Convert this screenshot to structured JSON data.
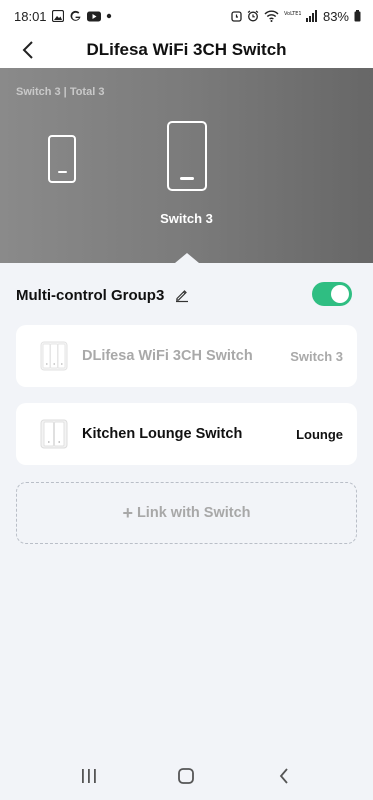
{
  "status_bar": {
    "time": "18:01",
    "battery": "83%",
    "left_icons": [
      "gallery-icon",
      "google-icon",
      "youtube-icon",
      "dot-icon"
    ],
    "right_icons": [
      "alarm-icon",
      "alarm-clock-icon",
      "wifi-icon",
      "volte-icon",
      "signal-icon",
      "battery-icon"
    ],
    "volte_label": "VoLTE1"
  },
  "header": {
    "title": "DLifesa WiFi 3CH Switch"
  },
  "hero": {
    "caption": "Switch 3 | Total 3",
    "selected_label": "Switch 3"
  },
  "group": {
    "title": "Multi-control Group3",
    "enabled": true
  },
  "devices": [
    {
      "name": "DLifesa WiFi 3CH Switch",
      "tag": "Switch 3",
      "dimmed": true
    },
    {
      "name": "Kitchen Lounge Switch",
      "tag": "Lounge",
      "dimmed": false
    }
  ],
  "link_button": {
    "plus": "+",
    "label": "Link with Switch"
  },
  "colors": {
    "toggle_on": "#2fbe82",
    "page_bg": "#f2f4f8"
  }
}
